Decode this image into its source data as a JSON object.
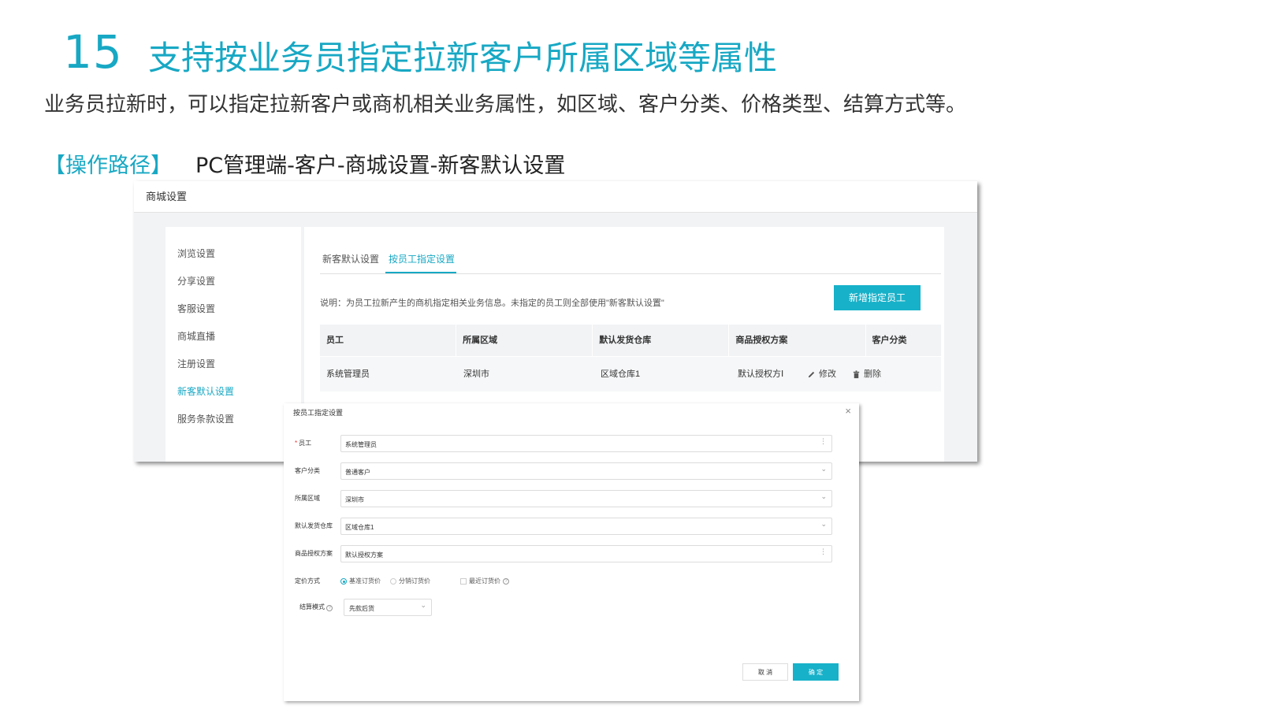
{
  "slide": {
    "number": "15",
    "title": "支持按业务员指定拉新客户所属区域等属性",
    "description": "业务员拉新时，可以指定拉新客户或商机相关业务属性，如区域、客户分类、价格类型、结算方式等。",
    "path_label": "【操作路径】",
    "path": "PC管理端-客户-商城设置-新客默认设置"
  },
  "window": {
    "title": "商城设置",
    "sidebar": [
      {
        "label": "浏览设置"
      },
      {
        "label": "分享设置"
      },
      {
        "label": "客服设置"
      },
      {
        "label": "商城直播"
      },
      {
        "label": "注册设置"
      },
      {
        "label": "新客默认设置"
      },
      {
        "label": "服务条款设置"
      }
    ],
    "tabs": [
      "新客默认设置",
      "按员工指定设置"
    ],
    "explain": "说明：为员工拉新产生的商机指定相关业务信息。未指定的员工则全部使用\"新客默认设置\"",
    "add_button": "新增指定员工",
    "table": {
      "headers": [
        "员工",
        "所属区域",
        "默认发货仓库",
        "商品授权方案",
        "客户分类"
      ],
      "rows": [
        {
          "employee": "系统管理员",
          "region": "深圳市",
          "warehouse": "区域仓库1",
          "plan": "默认授权方Ⅰ",
          "edit": "修改",
          "delete": "删除"
        }
      ]
    }
  },
  "dialog": {
    "title": "按员工指定设置",
    "fields": {
      "employee": {
        "label": "员工",
        "value": "系统管理员"
      },
      "category": {
        "label": "客户分类",
        "value": "普通客户"
      },
      "region": {
        "label": "所属区域",
        "value": "深圳市"
      },
      "warehouse": {
        "label": "默认发货仓库",
        "value": "区域仓库1"
      },
      "plan": {
        "label": "商品授权方案",
        "value": "默认授权方案"
      }
    },
    "pricing": {
      "label": "定价方式",
      "options": [
        "基准订货价",
        "分销订货价"
      ],
      "checkbox": "最近订货价",
      "selected": "基准订货价"
    },
    "settlement": {
      "label": "结算模式",
      "value": "先款后货"
    },
    "cancel": "取 消",
    "confirm": "确 定"
  },
  "colors": {
    "accent": "#17a8c4",
    "button": "#17b1c9"
  },
  "icons": [
    "close-icon",
    "chevron-down-icon",
    "more-icon",
    "edit-icon",
    "trash-icon",
    "help-icon"
  ]
}
